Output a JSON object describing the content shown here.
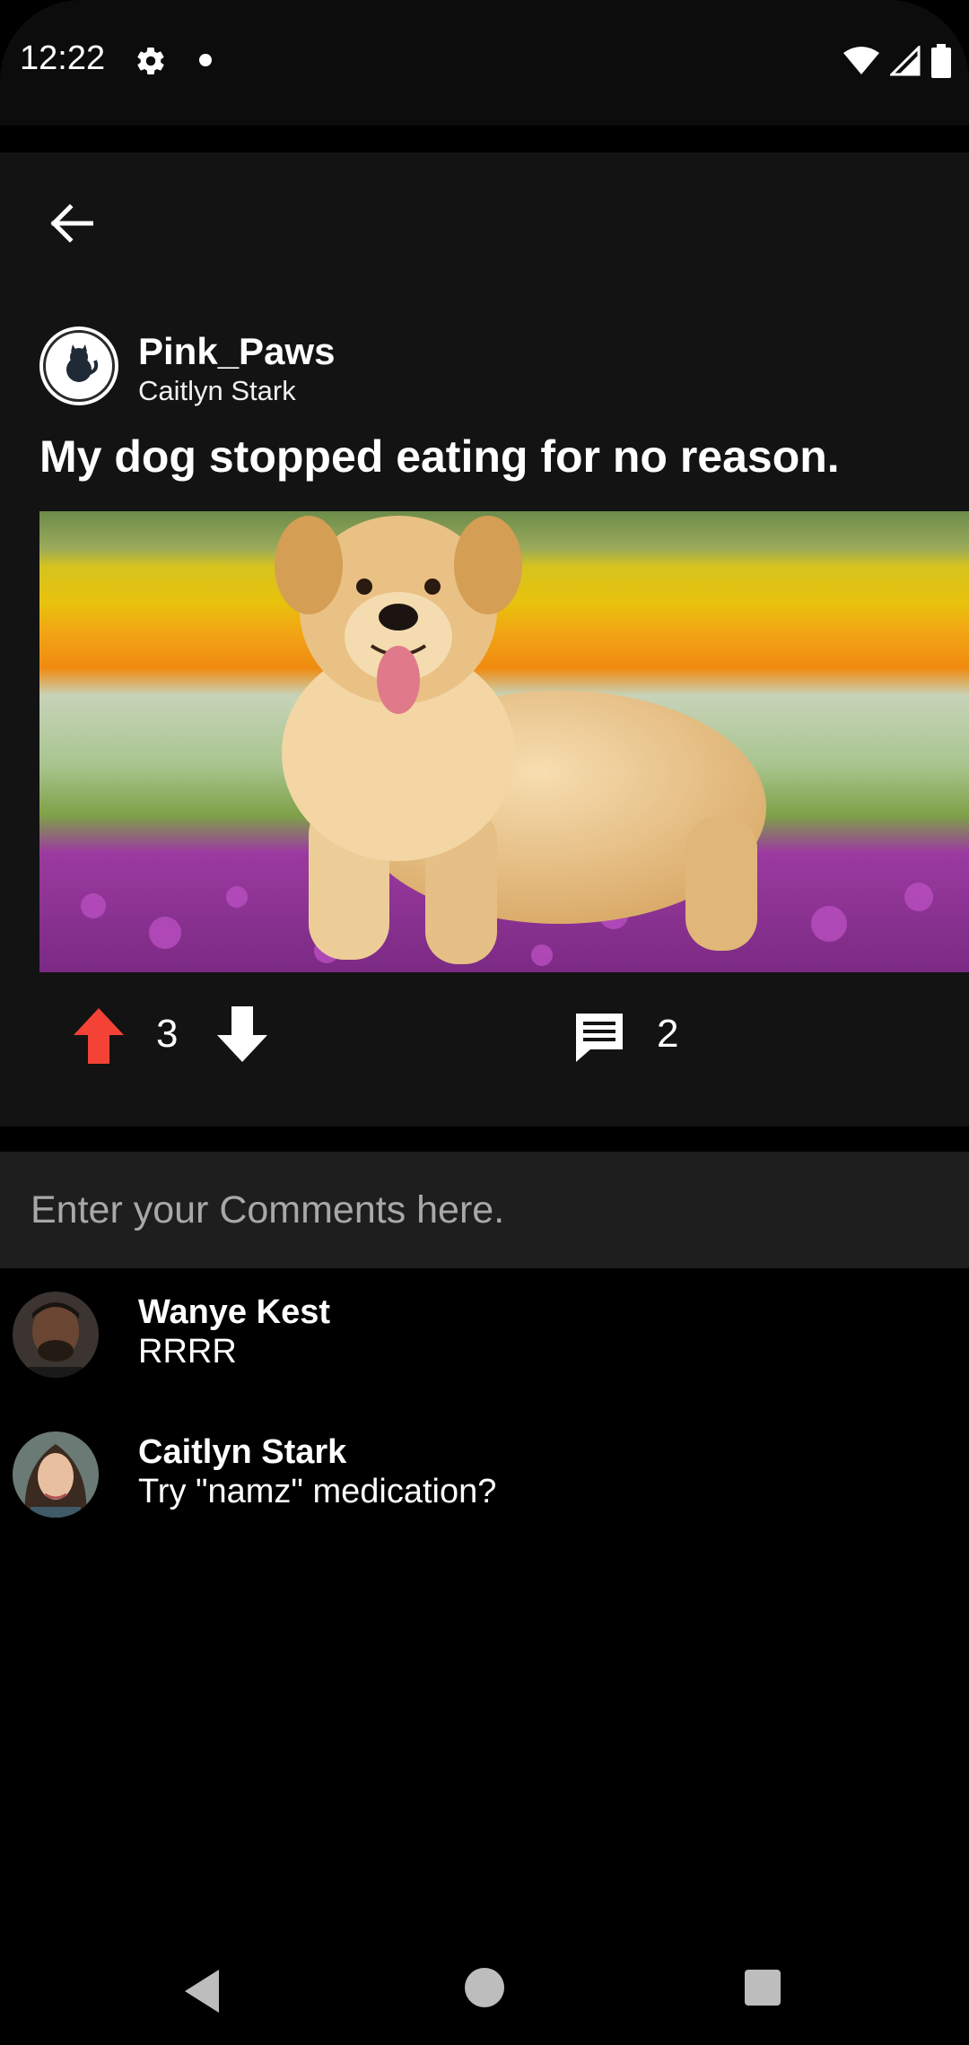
{
  "status_bar": {
    "time": "12:22"
  },
  "post": {
    "username": "Pink_Paws",
    "subname": "Caitlyn Stark",
    "title": "My dog stopped eating for no reason.",
    "image_icon": "golden-retriever-photo",
    "upvotes": "3",
    "comment_count": "2"
  },
  "comment_input": {
    "placeholder": "Enter your Comments here."
  },
  "comments": [
    {
      "author": "Wanye Kest",
      "text": "RRRR"
    },
    {
      "author": "Caitlyn Stark",
      "text": "Try \"namz\" medication?"
    }
  ],
  "colors": {
    "upvote_active": "#f44336",
    "background": "#000000",
    "card": "#131313",
    "input_bg": "#1e1e1e"
  }
}
